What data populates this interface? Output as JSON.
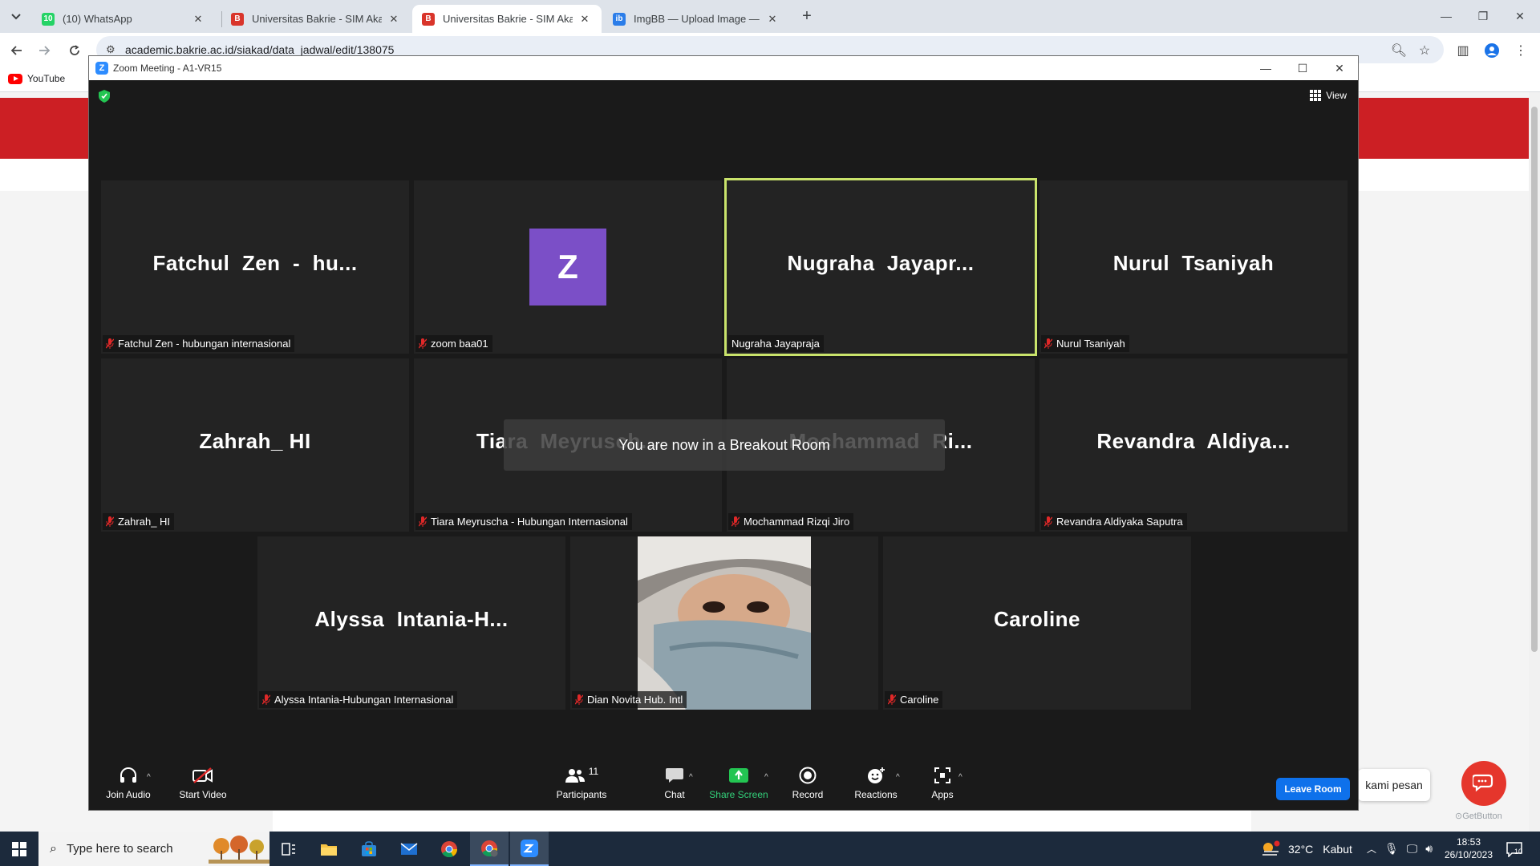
{
  "browser": {
    "tabs": [
      {
        "label": "(10) WhatsApp",
        "icon": "whatsapp-icon",
        "color": "#25d366",
        "active": false
      },
      {
        "label": "Universitas Bakrie - SIM Akade",
        "icon": "university-shield-icon",
        "color": "#d9352b",
        "active": false
      },
      {
        "label": "Universitas Bakrie - SIM Akade",
        "icon": "university-shield-icon",
        "color": "#d9352b",
        "active": true
      },
      {
        "label": "ImgBB — Upload Image — Fre",
        "icon": "imgbb-icon",
        "color": "#2b7de9",
        "active": false
      }
    ],
    "url": "academic.bakrie.ac.id/siakad/data_jadwal/edit/138075",
    "bookmarks": [
      {
        "label": "YouTube",
        "icon": "youtube-icon"
      }
    ]
  },
  "webpage": {
    "chat_bubble_text": "kami pesan",
    "getbutton_label": "GetButton",
    "colors": {
      "banner": "#cc1f24",
      "chat_fab": "#e5362c"
    }
  },
  "zoom": {
    "window_title": "Zoom Meeting - A1-VR15",
    "view_label": "View",
    "toast": "You are now in a Breakout Room",
    "participants": [
      {
        "big": "Fatchul  Zen  -  hu...",
        "tag": "Fatchul Zen - hubungan internasional",
        "type": "name",
        "speaking": false
      },
      {
        "big": "Z",
        "tag": "zoom baa01",
        "type": "avatar",
        "speaking": false
      },
      {
        "big": "Nugraha  Jayapr...",
        "tag": "Nugraha Jayapraja",
        "type": "name",
        "speaking": true
      },
      {
        "big": "Nurul  Tsaniyah",
        "tag": "Nurul Tsaniyah",
        "type": "name",
        "speaking": false
      },
      {
        "big": "Zahrah_ HI",
        "tag": "Zahrah_ HI",
        "type": "name",
        "speaking": false
      },
      {
        "big": "Tiara  Meyrusch...",
        "tag": "Tiara Meyruscha - Hubungan Internasional",
        "type": "name",
        "speaking": false
      },
      {
        "big": "Mochammad  Ri...",
        "tag": "Mochammad Rizqi Jiro",
        "type": "name",
        "speaking": false
      },
      {
        "big": "Revandra  Aldiya...",
        "tag": "Revandra Aldiyaka Saputra",
        "type": "name",
        "speaking": false
      },
      {
        "big": "Alyssa  Intania-H...",
        "tag": "Alyssa Intania-Hubungan Internasional",
        "type": "name",
        "speaking": false
      },
      {
        "big": "",
        "tag": "Dian Novita Hub. Intl",
        "type": "video",
        "speaking": false
      },
      {
        "big": "Caroline",
        "tag": "Caroline",
        "type": "name",
        "speaking": false
      }
    ],
    "toolbar": {
      "join_audio": "Join Audio",
      "start_video": "Start Video",
      "participants": "Participants",
      "participants_count": "11",
      "chat": "Chat",
      "share_screen": "Share Screen",
      "record": "Record",
      "reactions": "Reactions",
      "apps": "Apps",
      "leave_room": "Leave Room"
    },
    "colors": {
      "speaking_border": "#c9e36b",
      "share_green": "#33d17a",
      "leave_blue": "#0e71eb",
      "avatar_purple": "#7b4fc7"
    }
  },
  "taskbar": {
    "search_placeholder": "Type here to search",
    "weather_temp": "32°C",
    "weather_desc": "Kabut",
    "time": "18:53",
    "date": "26/10/2023",
    "notification_count": "10",
    "apps": [
      "task-view-icon",
      "file-explorer-icon",
      "microsoft-store-icon",
      "mail-icon",
      "chrome-icon",
      "chrome-profile-icon",
      "zoom-icon"
    ]
  }
}
